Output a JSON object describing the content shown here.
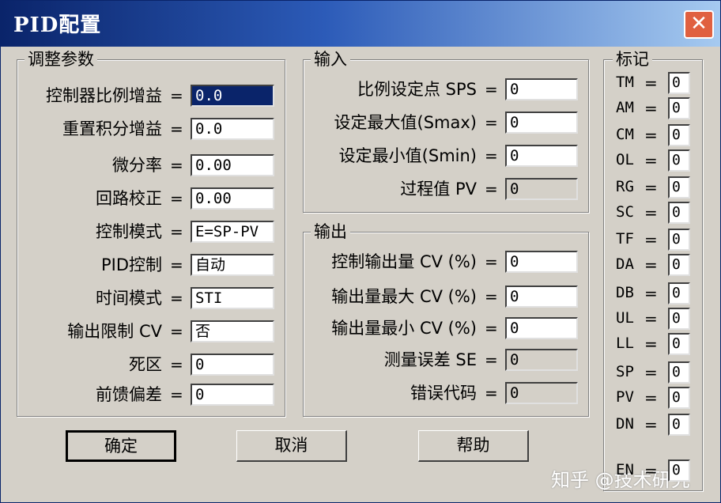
{
  "window": {
    "title": "PID配置",
    "close_icon": "close-icon"
  },
  "tuning": {
    "title": "调整参数",
    "rows": [
      {
        "label": "控制器比例增益",
        "value": "0.0",
        "selected": true
      },
      {
        "label": "重置积分增益",
        "value": "0.0"
      },
      {
        "label": "微分率",
        "value": "0.00"
      },
      {
        "label": "回路校正",
        "value": "0.00"
      },
      {
        "label": "控制模式",
        "value": "E=SP-PV"
      },
      {
        "label": "PID控制",
        "value": "自动"
      },
      {
        "label": "时间模式",
        "value": "STI"
      },
      {
        "label": "输出限制 CV",
        "value": "否"
      },
      {
        "label": "死区",
        "value": "0"
      },
      {
        "label": "前馈偏差",
        "value": "0"
      }
    ]
  },
  "input": {
    "title": "输入",
    "rows": [
      {
        "label": "比例设定点 SPS",
        "value": "0"
      },
      {
        "label": "设定最大值(Smax)",
        "value": "0"
      },
      {
        "label": "设定最小值(Smin)",
        "value": "0"
      },
      {
        "label": "过程值 PV",
        "value": "0"
      }
    ]
  },
  "output": {
    "title": "输出",
    "rows": [
      {
        "label": "控制输出量 CV (%)",
        "value": "0"
      },
      {
        "label": "输出量最大 CV (%)",
        "value": "0"
      },
      {
        "label": "输出量最小 CV (%)",
        "value": "0"
      },
      {
        "label": "测量误差 SE",
        "value": "0"
      },
      {
        "label": "错误代码",
        "value": "0"
      }
    ]
  },
  "flags": {
    "title": "标记",
    "items": [
      {
        "label": "TM",
        "value": "0"
      },
      {
        "label": "AM",
        "value": "0"
      },
      {
        "label": "CM",
        "value": "0"
      },
      {
        "label": "OL",
        "value": "0"
      },
      {
        "label": "RG",
        "value": "0"
      },
      {
        "label": "SC",
        "value": "0"
      },
      {
        "label": "TF",
        "value": "0"
      },
      {
        "label": "DA",
        "value": "0"
      },
      {
        "label": "DB",
        "value": "0"
      },
      {
        "label": "UL",
        "value": "0"
      },
      {
        "label": "LL",
        "value": "0"
      },
      {
        "label": "SP",
        "value": "0"
      },
      {
        "label": "PV",
        "value": "0"
      },
      {
        "label": "DN",
        "value": "0"
      },
      {
        "label": "EN",
        "value": "0"
      }
    ]
  },
  "buttons": {
    "ok": "确定",
    "cancel": "取消",
    "help": "帮助"
  },
  "eq": "=",
  "watermark": "知乎 @技术研究"
}
